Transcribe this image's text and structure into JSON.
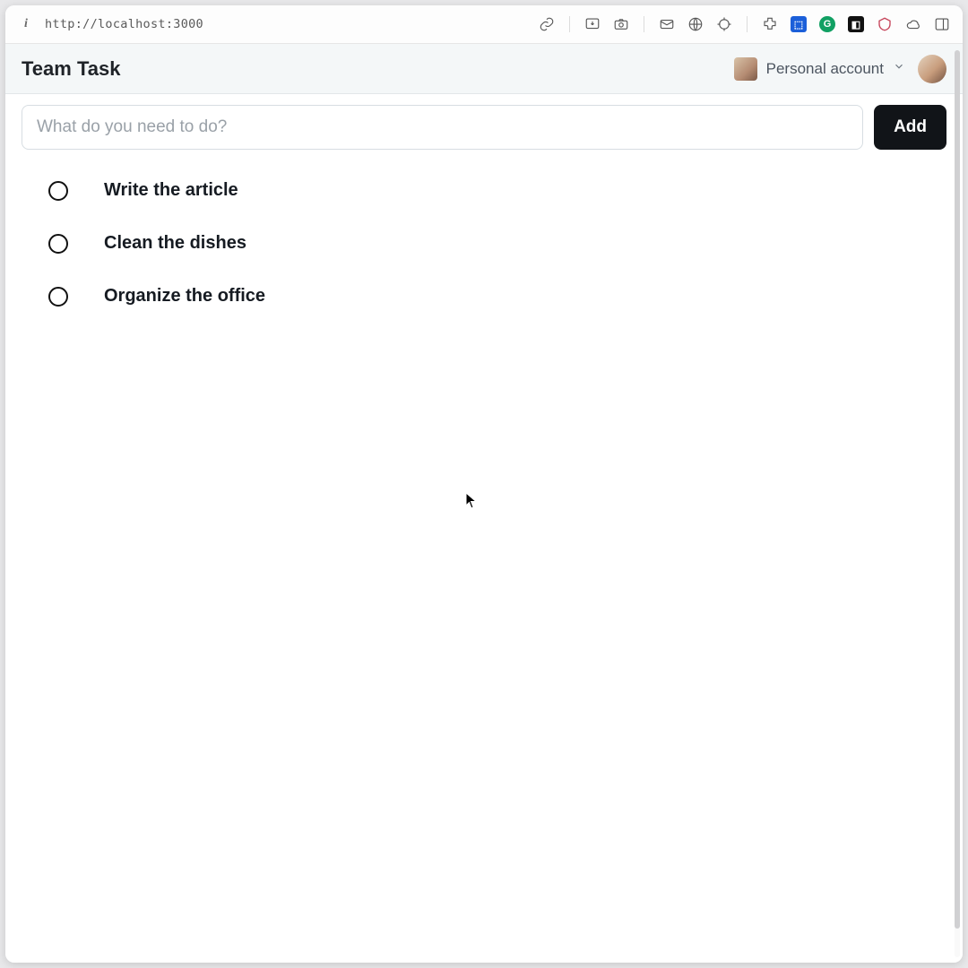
{
  "browser": {
    "url": "http://localhost:3000"
  },
  "header": {
    "app_title": "Team Task",
    "account_label": "Personal account"
  },
  "task_form": {
    "placeholder": "What do you need to do?",
    "add_button": "Add"
  },
  "tasks": [
    {
      "text": "Write the article",
      "done": false
    },
    {
      "text": "Clean the dishes",
      "done": false
    },
    {
      "text": "Organize the office",
      "done": false
    }
  ]
}
